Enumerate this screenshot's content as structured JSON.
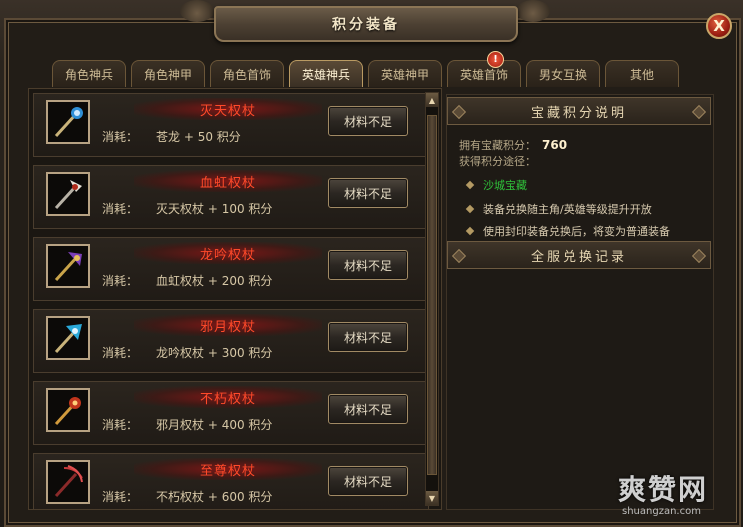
{
  "window": {
    "title": "积分装备",
    "close_symbol": "X"
  },
  "tabs": [
    {
      "label": "角色神兵",
      "active": false
    },
    {
      "label": "角色神甲",
      "active": false
    },
    {
      "label": "角色首饰",
      "active": false
    },
    {
      "label": "英雄神兵",
      "active": true
    },
    {
      "label": "英雄神甲",
      "active": false
    },
    {
      "label": "英雄首饰",
      "active": false,
      "alert": "!"
    },
    {
      "label": "男女互换",
      "active": false
    },
    {
      "label": "其他",
      "active": false
    }
  ],
  "items": [
    {
      "name": "灭天权杖",
      "cost_label": "消耗：",
      "cost": "苍龙 + 50 积分",
      "button": "材料不足",
      "icon": "staff-icon"
    },
    {
      "name": "血虹权杖",
      "cost_label": "消耗：",
      "cost": "灭天权杖 + 100 积分",
      "button": "材料不足",
      "icon": "staff-icon"
    },
    {
      "name": "龙吟权杖",
      "cost_label": "消耗：",
      "cost": "血虹权杖 + 200 积分",
      "button": "材料不足",
      "icon": "staff-icon"
    },
    {
      "name": "邪月权杖",
      "cost_label": "消耗：",
      "cost": "龙吟权杖 + 300 积分",
      "button": "材料不足",
      "icon": "staff-icon"
    },
    {
      "name": "不朽权杖",
      "cost_label": "消耗：",
      "cost": "邪月权杖 + 400 积分",
      "button": "材料不足",
      "icon": "staff-icon"
    },
    {
      "name": "至尊权杖",
      "cost_label": "消耗：",
      "cost": "不朽权杖 + 600 积分",
      "button": "材料不足",
      "icon": "staff-icon"
    }
  ],
  "info": {
    "header": "宝藏积分说明",
    "owned_label": "拥有宝藏积分：",
    "owned_value": "760",
    "ways_label": "获得积分途径：",
    "ways": [
      {
        "text": "沙城宝藏",
        "color": "#2fc13a"
      },
      {
        "text": "装备兑换随主角/英雄等级提升开放",
        "color": "#d8cbb0"
      },
      {
        "text": "使用封印装备兑换后，将变为普通装备",
        "color": "#d8cbb0"
      }
    ],
    "record_header": "全服兑换记录"
  },
  "watermark": {
    "big": "爽赞网",
    "small": "shuangzan.com"
  },
  "colors": {
    "item_name": "#ff4a2a",
    "accent_gold": "#b99a62",
    "close_red": "#9c1f12"
  }
}
